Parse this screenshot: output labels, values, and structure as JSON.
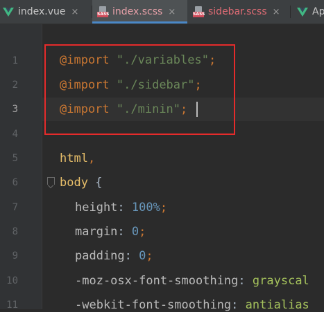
{
  "tabs": [
    {
      "label": "index.vue",
      "icon": "vue-icon",
      "type": "vue"
    },
    {
      "label": "index.scss",
      "icon": "sass-icon",
      "type": "sass"
    },
    {
      "label": "sidebar.scss",
      "icon": "sass-icon",
      "type": "sass"
    },
    {
      "label": "Ap",
      "icon": "vue-icon",
      "type": "vue"
    }
  ],
  "sass_badge": "SASS",
  "close_glyph": "×",
  "line_numbers": [
    "1",
    "2",
    "3",
    "4",
    "5",
    "6",
    "7",
    "8",
    "9",
    "10",
    "11"
  ],
  "code": {
    "import_kw": "@import",
    "import_1": "\"./variables\"",
    "import_2": "\"./sidebar\"",
    "import_3": "\"./minin\"",
    "semicolon": ";",
    "sel_html": "html",
    "comma": ",",
    "sel_body": "body",
    "brace": "{",
    "prop_height": "height",
    "val_height": "100%",
    "prop_margin": "margin",
    "val_margin": "0",
    "prop_padding": "padding",
    "val_padding": "0",
    "prop_moz": "-moz-osx-font-smoothing",
    "val_moz": "grayscal",
    "prop_webkit": "-webkit-font-smoothing",
    "val_webkit": "antialias",
    "colon": ":"
  },
  "colors": {
    "accent": "#4a88c7",
    "highlight_box": "#e52b2b",
    "editor_bg": "#2b2b2b"
  }
}
